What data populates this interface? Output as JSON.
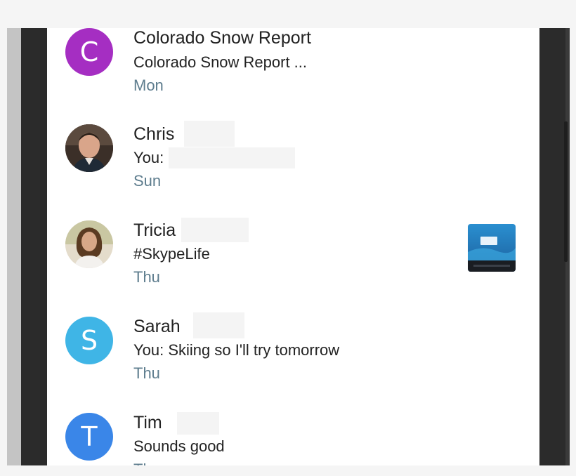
{
  "colors": {
    "purple_avatar": "#a52ec2",
    "sarah_avatar": "#3fb5e6",
    "tim_avatar": "#3a86e8",
    "time_text": "#5e7d8e"
  },
  "conversations": [
    {
      "name": "Colorado Snow Report",
      "preview": "Colorado Snow Report ...",
      "time": "Mon",
      "avatar_initial": "C",
      "avatar_type": "initial"
    },
    {
      "name": "Chris",
      "preview": "You:",
      "time": "Sun",
      "avatar_type": "photo",
      "avatar_icon": "profile-photo-icon"
    },
    {
      "name": "Tricia",
      "preview": "#SkypeLife",
      "time": "Thu",
      "avatar_type": "photo",
      "avatar_icon": "profile-photo-icon",
      "attachment_icon": "image-thumbnail-icon"
    },
    {
      "name": "Sarah",
      "preview": "You: Skiing so I'll try tomorrow",
      "time": "Thu",
      "avatar_initial": "S",
      "avatar_type": "initial"
    },
    {
      "name": "Tim",
      "preview": "Sounds good",
      "time": "Th",
      "avatar_initial": "T",
      "avatar_type": "initial"
    }
  ]
}
